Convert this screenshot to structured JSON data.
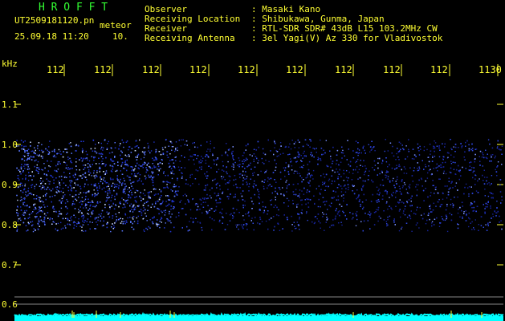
{
  "header": {
    "app_name": "H R O F F T",
    "filename": "UT2509181120.pn",
    "mode": "meteor",
    "datetime": "25.09.18 11:20",
    "duration": "10.",
    "fields": [
      {
        "label": "Observer",
        "value": ": Masaki Kano"
      },
      {
        "label": "Receiving Location",
        "value": ": Shibukawa, Gunma, Japan"
      },
      {
        "label": "Receiver",
        "value": ": RTL-SDR SDR# 43dB L15 103.2MHz CW"
      },
      {
        "label": "Receiving Antenna",
        "value": ": 3el Yagi(V) Az 330 for Vladivostok"
      }
    ]
  },
  "axis": {
    "unit": "kHz",
    "y_labels": [
      "1.1",
      "1.0",
      "0.9",
      "0.8",
      "0.7",
      "0.6"
    ],
    "x_labels": [
      "112",
      "112",
      "112",
      "112",
      "112",
      "112",
      "112",
      "112",
      "112",
      "1130"
    ]
  },
  "colors": {
    "text": "#ffff33",
    "title": "#33ff33",
    "spectrum": "#2233ff",
    "baseline": "#00ffff"
  },
  "signal": {
    "strong_band": "0.80-1.00 kHz",
    "strong_until_minute_fraction": 0.33
  }
}
